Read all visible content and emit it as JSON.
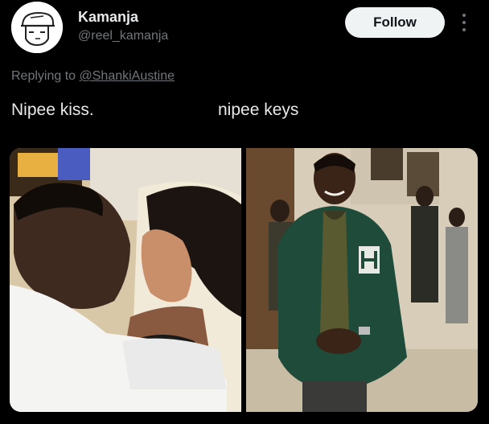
{
  "post": {
    "author_name": "Kamanja",
    "author_handle": "@reel_kamanja",
    "follow_label": "Follow",
    "reply_prefix": "Replying to",
    "reply_to": "@ShankiAustine",
    "caption_left": "Nipee kiss.",
    "caption_right": "nipee keys",
    "more_icon": "more-vertical-icon",
    "avatar_icon": "sketch-face-avatar"
  },
  "media": {
    "left_image": "photo-couple-kissing",
    "right_image": "photo-man-green-jacket"
  },
  "colors": {
    "background": "#000000",
    "text_primary": "#e7e9ea",
    "text_secondary": "#71767b",
    "follow_bg": "#eff3f4",
    "follow_text": "#0f1419"
  }
}
